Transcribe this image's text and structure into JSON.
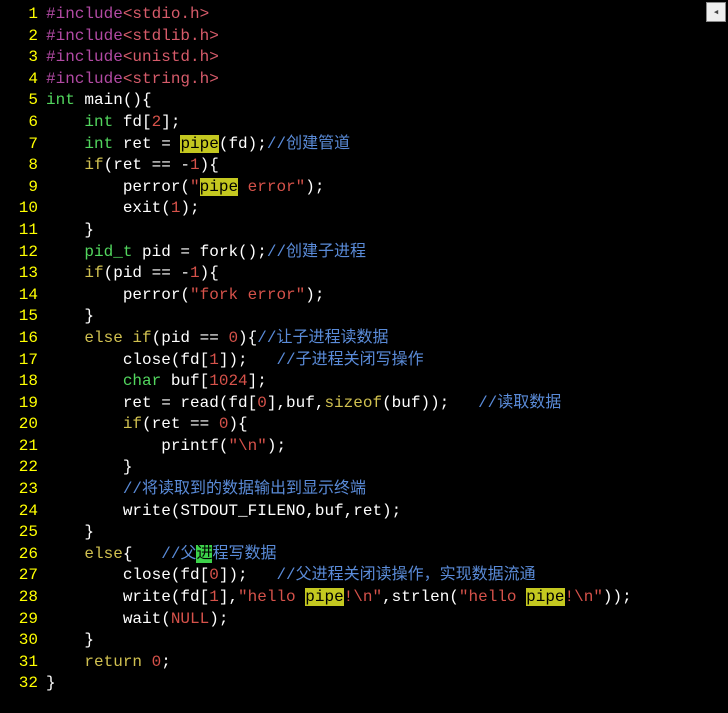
{
  "lines": {
    "l1": {
      "num": "1",
      "preproc": "#include",
      "inc": "<stdio.h>"
    },
    "l2": {
      "num": "2",
      "preproc": "#include",
      "inc": "<stdlib.h>"
    },
    "l3": {
      "num": "3",
      "preproc": "#include",
      "inc": "<unistd.h>"
    },
    "l4": {
      "num": "4",
      "preproc": "#include",
      "inc": "<string.h>"
    },
    "l5": {
      "num": "5",
      "type": "int",
      "rest": " main(){"
    },
    "l6": {
      "num": "6",
      "indent": "    ",
      "type": "int",
      "rest1": " fd[",
      "num1": "2",
      "rest2": "];"
    },
    "l7": {
      "num": "7",
      "indent": "    ",
      "type": "int",
      "rest1": " ret = ",
      "hl": "pipe",
      "rest2": "(fd);",
      "comment": "//创建管道"
    },
    "l8": {
      "num": "8",
      "indent": "    ",
      "kw": "if",
      "rest1": "(ret == -",
      "num1": "1",
      "rest2": "){"
    },
    "l9": {
      "num": "9",
      "indent": "        ",
      "rest1": "perror(",
      "str1": "\"",
      "hl": "pipe",
      "str2": " error\"",
      "rest2": ");"
    },
    "l10": {
      "num": "10",
      "indent": "        ",
      "rest1": "exit(",
      "num1": "1",
      "rest2": ");"
    },
    "l11": {
      "num": "11",
      "indent": "    ",
      "rest": "}"
    },
    "l12": {
      "num": "12",
      "indent": "    ",
      "type": "pid_t",
      "rest1": " pid = fork();",
      "comment": "//创建子进程"
    },
    "l13": {
      "num": "13",
      "indent": "    ",
      "kw": "if",
      "rest1": "(pid == -",
      "num1": "1",
      "rest2": "){"
    },
    "l14": {
      "num": "14",
      "indent": "        ",
      "rest1": "perror(",
      "str": "\"fork error\"",
      "rest2": ");"
    },
    "l15": {
      "num": "15",
      "indent": "    ",
      "rest": "}"
    },
    "l16": {
      "num": "16",
      "indent": "    ",
      "kw": "else if",
      "rest1": "(pid == ",
      "num1": "0",
      "rest2": "){",
      "comment": "//让子进程读数据"
    },
    "l17": {
      "num": "17",
      "indent": "        ",
      "rest1": "close(fd[",
      "num1": "1",
      "rest2": "]);   ",
      "comment": "//子进程关闭写操作"
    },
    "l18": {
      "num": "18",
      "indent": "        ",
      "type": "char",
      "rest1": " buf[",
      "num1": "1024",
      "rest2": "];"
    },
    "l19": {
      "num": "19",
      "indent": "        ",
      "rest1": "ret = read(fd[",
      "num1": "0",
      "rest2": "],buf,",
      "kw": "sizeof",
      "rest3": "(buf));   ",
      "comment": "//读取数据"
    },
    "l20": {
      "num": "20",
      "indent": "        ",
      "kw": "if",
      "rest1": "(ret == ",
      "num1": "0",
      "rest2": "){"
    },
    "l21": {
      "num": "21",
      "indent": "            ",
      "rest1": "printf(",
      "str": "\"\\n\"",
      "rest2": ");"
    },
    "l22": {
      "num": "22",
      "indent": "        ",
      "rest": "}"
    },
    "l23": {
      "num": "23",
      "indent": "        ",
      "comment": "//将读取到的数据输出到显示终端"
    },
    "l24": {
      "num": "24",
      "indent": "        ",
      "rest": "write(STDOUT_FILENO,buf,ret);"
    },
    "l25": {
      "num": "25",
      "indent": "    ",
      "rest": "}"
    },
    "l26": {
      "num": "26",
      "indent": "    ",
      "kw": "else",
      "rest1": "{   ",
      "cmt1": "//父",
      "cursor": "进",
      "cmt2": "程写数据"
    },
    "l27": {
      "num": "27",
      "indent": "        ",
      "rest1": "close(fd[",
      "num1": "0",
      "rest2": "]);   ",
      "comment": "//父进程关闭读操作，实现数据流通"
    },
    "l28": {
      "num": "28",
      "indent": "        ",
      "rest1": "write(fd[",
      "num1": "1",
      "rest2": "],",
      "str1": "\"hello ",
      "hl1": "pipe",
      "str2": "!\\n\"",
      "rest3": ",strlen(",
      "str3": "\"hello ",
      "hl2": "pipe",
      "str4": "!\\n\"",
      "rest4": "));"
    },
    "l29": {
      "num": "29",
      "indent": "        ",
      "rest1": "wait(",
      "const": "NULL",
      "rest2": ");"
    },
    "l30": {
      "num": "30",
      "indent": "    ",
      "rest": "}"
    },
    "l31": {
      "num": "31",
      "indent": "    ",
      "kw": "return",
      "rest1": " ",
      "num1": "0",
      "rest2": ";"
    },
    "l32": {
      "num": "32",
      "rest": "}"
    }
  },
  "scroll_glyph": "◂"
}
